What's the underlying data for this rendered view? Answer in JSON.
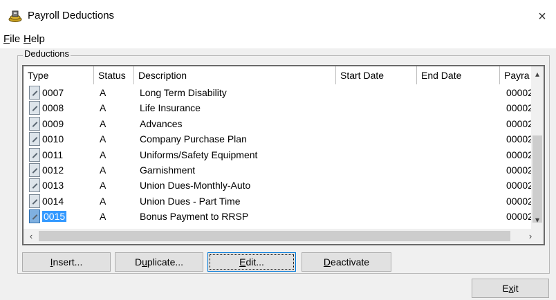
{
  "window": {
    "title": "Payroll Deductions",
    "close_glyph": "×"
  },
  "menu": {
    "file": {
      "key": "F",
      "rest": "ile"
    },
    "help": {
      "key": "H",
      "rest": "elp"
    }
  },
  "group_label": "Deductions",
  "columns": [
    "Type",
    "Status",
    "Description",
    "Start Date",
    "End Date",
    "Payra"
  ],
  "rows": [
    {
      "type": "0007",
      "status": "A",
      "description": "Long Term Disability",
      "payra": "00002"
    },
    {
      "type": "0008",
      "status": "A",
      "description": "Life Insurance",
      "payra": "00002"
    },
    {
      "type": "0009",
      "status": "A",
      "description": "Advances",
      "payra": "00002"
    },
    {
      "type": "0010",
      "status": "A",
      "description": "Company Purchase Plan",
      "payra": "00002"
    },
    {
      "type": "0011",
      "status": "A",
      "description": "Uniforms/Safety Equipment",
      "payra": "00002"
    },
    {
      "type": "0012",
      "status": "A",
      "description": "Garnishment",
      "payra": "00002"
    },
    {
      "type": "0013",
      "status": "A",
      "description": "Union Dues-Monthly-Auto",
      "payra": "00002"
    },
    {
      "type": "0014",
      "status": "A",
      "description": "Union Dues - Part Time",
      "payra": "00002"
    },
    {
      "type": "0015",
      "status": "A",
      "description": "Bonus Payment to RRSP",
      "payra": "00002"
    }
  ],
  "selected_index": 8,
  "buttons": {
    "insert": {
      "key": "I",
      "rest": "nsert..."
    },
    "duplicate": {
      "pre": "D",
      "key": "u",
      "rest": "plicate..."
    },
    "edit": {
      "key": "E",
      "rest": "dit..."
    },
    "deactivate": {
      "key": "D",
      "rest": "eactivate"
    },
    "exit": {
      "pre": "E",
      "key": "x",
      "rest": "it"
    }
  },
  "icons": {
    "app": "payroll-app-icon",
    "row": "deduction-row-icon"
  },
  "colors": {
    "selection": "#3399ff"
  }
}
